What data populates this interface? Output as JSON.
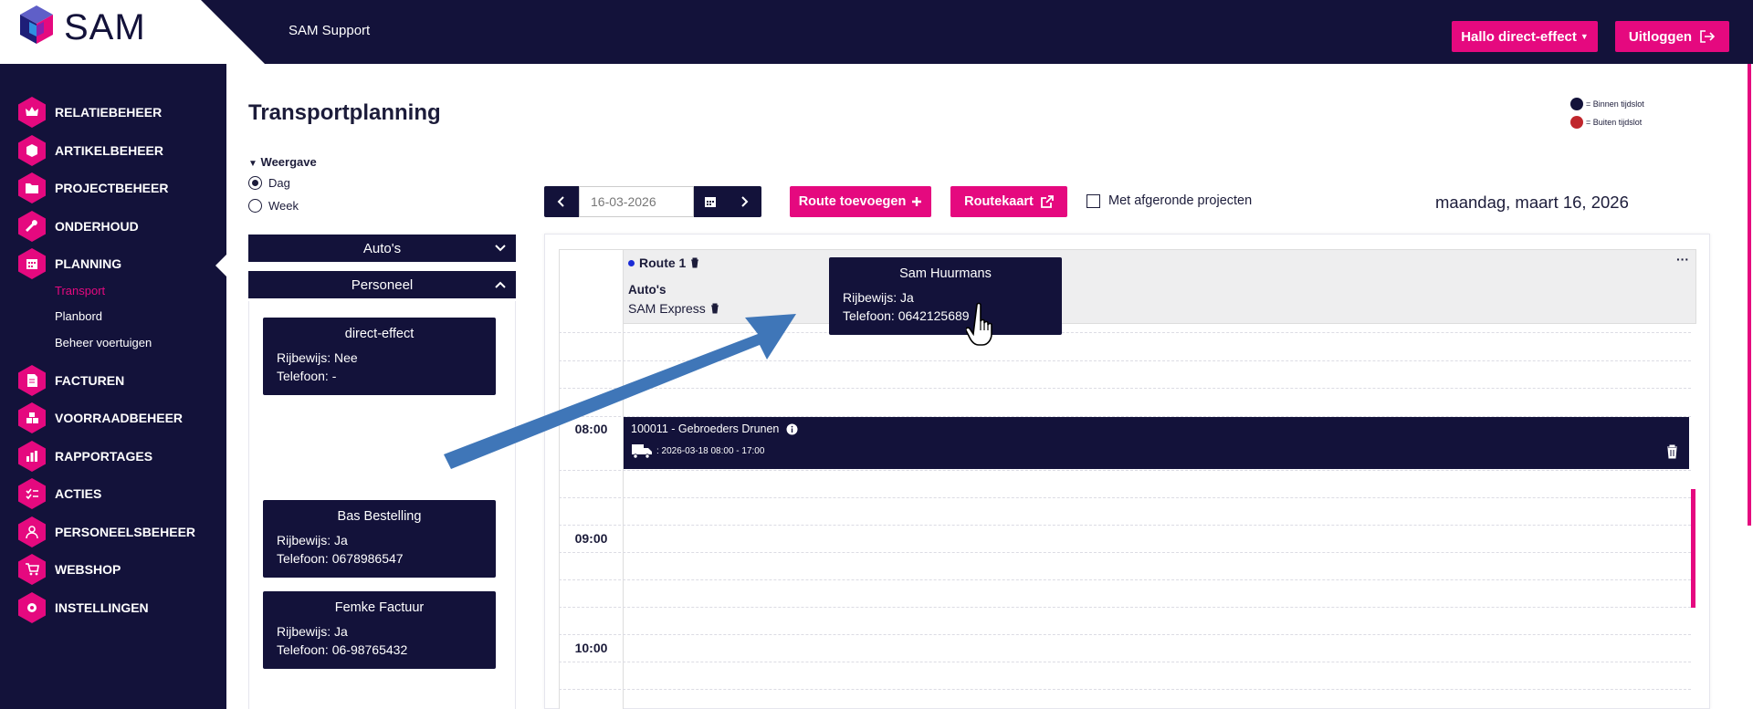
{
  "app": {
    "logo_text": "SAM",
    "support_label": "SAM Support",
    "hello_label": "Hallo direct-effect",
    "logout_label": "Uitloggen"
  },
  "sidebar": {
    "items": [
      {
        "label": "RELATIEBEHEER",
        "icon": "crown-icon"
      },
      {
        "label": "ARTIKELBEHEER",
        "icon": "box-icon"
      },
      {
        "label": "PROJECTBEHEER",
        "icon": "folder-icon"
      },
      {
        "label": "ONDERHOUD",
        "icon": "wrench-icon"
      },
      {
        "label": "PLANNING",
        "icon": "calendar-icon"
      },
      {
        "label": "FACTUREN",
        "icon": "invoice-icon"
      },
      {
        "label": "VOORRAADBEHEER",
        "icon": "boxes-icon"
      },
      {
        "label": "RAPPORTAGES",
        "icon": "bar-chart-icon"
      },
      {
        "label": "ACTIES",
        "icon": "checklist-icon"
      },
      {
        "label": "PERSONEELSBEHEER",
        "icon": "user-icon"
      },
      {
        "label": "WEBSHOP",
        "icon": "cart-icon"
      },
      {
        "label": "INSTELLINGEN",
        "icon": "gear-icon"
      }
    ],
    "subitems": [
      {
        "label": "Transport",
        "active": true
      },
      {
        "label": "Planbord",
        "active": false
      },
      {
        "label": "Beheer voertuigen",
        "active": false
      }
    ]
  },
  "page": {
    "title": "Transportplanning",
    "legend": {
      "inside": "= Binnen tijdslot",
      "outside": "= Buiten tijdslot",
      "inside_color": "#13123a",
      "outside_color": "#c0262c"
    },
    "view": {
      "title": "Weergave",
      "options": [
        "Dag",
        "Week"
      ],
      "selected": "Dag"
    },
    "accordions": {
      "cars": "Auto's",
      "staff": "Personeel"
    },
    "staff": [
      {
        "name": "direct-effect",
        "license": "Rijbewijs: Nee",
        "phone": "Telefoon: -"
      },
      {
        "name": "Bas Bestelling",
        "license": "Rijbewijs: Ja",
        "phone": "Telefoon: 0678986547"
      },
      {
        "name": "Femke Factuur",
        "license": "Rijbewijs: Ja",
        "phone": "Telefoon: 06-98765432"
      }
    ]
  },
  "toolbar": {
    "date_value": "16-03-2026",
    "route_add_label": "Route toevoegen",
    "routekaart_label": "Routekaart",
    "completed_label": "Met afgeronde projecten",
    "current_date": "maandag, maart 16, 2026"
  },
  "calendar": {
    "route_title": "Route 1",
    "autos_title": "Auto's",
    "autos_value": "SAM Express",
    "more": "···",
    "times": [
      "08:00",
      "09:00",
      "10:00"
    ],
    "event": {
      "title": "100011 - Gebroeders Drunen",
      "time": ": 2026-03-18 08:00 - 17:00"
    }
  },
  "tooltip": {
    "name": "Sam Huurmans",
    "license": "Rijbewijs: Ja",
    "phone": "Telefoon: 0642125689"
  },
  "colors": {
    "navy": "#13123a",
    "accent": "#e5097f",
    "arrow": "#3f76b8"
  }
}
